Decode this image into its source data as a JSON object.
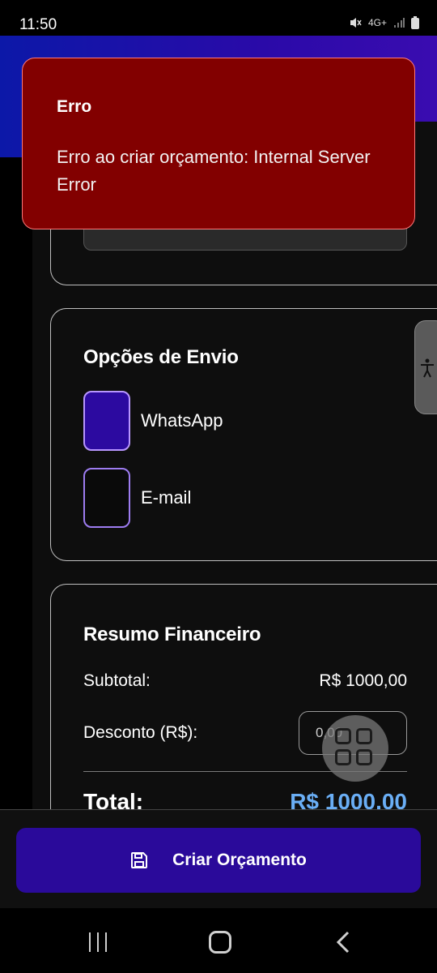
{
  "status_bar": {
    "time": "11:50",
    "network_label": "4G+"
  },
  "envio": {
    "title": "Opções de Envio",
    "options": [
      {
        "label": "WhatsApp",
        "checked": true
      },
      {
        "label": "E-mail",
        "checked": false
      }
    ]
  },
  "resumo": {
    "title": "Resumo Financeiro",
    "subtotal_label": "Subtotal:",
    "subtotal_value": "R$ 1000,00",
    "desconto_label": "Desconto (R$):",
    "desconto_placeholder": "0,00",
    "total_label": "Total:",
    "total_value": "R$ 1000.00"
  },
  "actions": {
    "create_label": "Criar Orçamento"
  },
  "toast": {
    "title": "Erro",
    "message": "Erro ao criar orçamento: Internal Server Error"
  },
  "colors": {
    "header_gradient_start": "#0c18a8",
    "header_gradient_end": "#3a0cb0",
    "checkbox_checked": "#2c0aa0",
    "primary_button": "#2a0a9a",
    "total_value": "#6aaef5",
    "error_toast": "#820000"
  },
  "icons": {
    "menu": "menu-icon",
    "accessibility": "accessibility-icon",
    "save": "save-icon",
    "quick_actions": "grid-icon",
    "nav_recent": "recent-apps-icon",
    "nav_home": "home-icon",
    "nav_back": "back-icon"
  }
}
